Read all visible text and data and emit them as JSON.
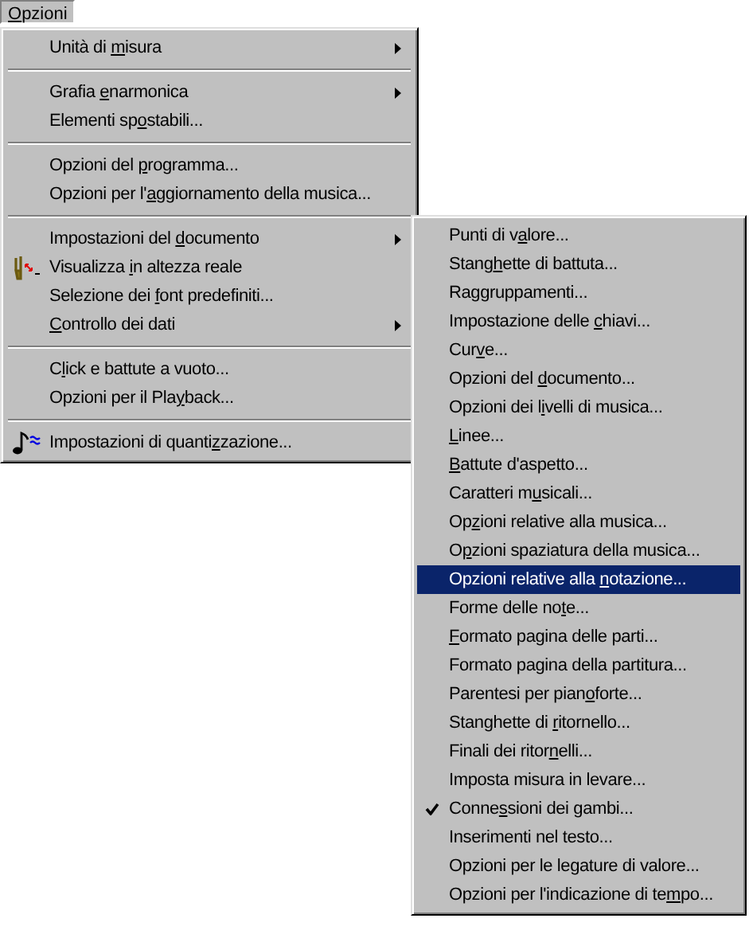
{
  "menu_bar": [
    {
      "label": {
        "key": "O",
        "after": "pzioni"
      },
      "selected": true
    }
  ],
  "menu": [
    {
      "kind": "submenu",
      "label": {
        "before": "Unità di ",
        "key": "m",
        "after": "isura"
      }
    },
    {
      "kind": "separator"
    },
    {
      "kind": "submenu",
      "label": {
        "before": "Grafia ",
        "key": "e",
        "after": "narmonica"
      }
    },
    {
      "kind": "command",
      "label": {
        "before": "Elementi sp",
        "key": "o",
        "after": "stabili..."
      }
    },
    {
      "kind": "separator"
    },
    {
      "kind": "command",
      "label": {
        "before": "Opzioni del ",
        "key": "p",
        "after": "rogramma..."
      }
    },
    {
      "kind": "command",
      "label": {
        "before": "Opzioni per l'",
        "key": "a",
        "after": "ggiornamento della musica..."
      }
    },
    {
      "kind": "separator"
    },
    {
      "kind": "submenu",
      "label": {
        "before": "Impostazioni del ",
        "key": "d",
        "after": "ocumento"
      }
    },
    {
      "kind": "pitch-command",
      "label": {
        "before": "Visualizza ",
        "key": "i",
        "after": "n altezza reale"
      }
    },
    {
      "kind": "command",
      "label": {
        "before": "Selezione dei ",
        "key": "f",
        "after": "ont predefiniti..."
      }
    },
    {
      "kind": "submenu",
      "label": {
        "key": "C",
        "after": "ontrollo dei dati"
      }
    },
    {
      "kind": "separator"
    },
    {
      "kind": "command",
      "label": {
        "before": "C",
        "key": "l",
        "after": "ick e battute a vuoto..."
      }
    },
    {
      "kind": "command",
      "label": {
        "before": "Opzioni per il Pla",
        "key": "y",
        "after": "back..."
      }
    },
    {
      "kind": "separator"
    },
    {
      "kind": "quantize-command",
      "label": {
        "before": "Impostazioni di quanti",
        "key": "z",
        "after": "zazione..."
      }
    }
  ],
  "submenu": [
    {
      "label": {
        "before": "Punti di v",
        "key": "a",
        "after": "lore..."
      },
      "checked": false,
      "selected": false
    },
    {
      "label": {
        "before": "Stang",
        "key": "h",
        "after": "ette di battuta..."
      },
      "checked": false,
      "selected": false
    },
    {
      "label": {
        "before": "Raggruppamenti..."
      },
      "checked": false,
      "selected": false
    },
    {
      "label": {
        "before": "Impostazione delle ",
        "key": "c",
        "after": "hiavi..."
      },
      "checked": false,
      "selected": false
    },
    {
      "label": {
        "before": "Cur",
        "key": "v",
        "after": "e..."
      },
      "checked": false,
      "selected": false
    },
    {
      "label": {
        "before": "Opzioni del ",
        "key": "d",
        "after": "ocumento..."
      },
      "checked": false,
      "selected": false
    },
    {
      "label": {
        "before": "Opzioni dei l",
        "key": "i",
        "after": "velli di musica..."
      },
      "checked": false,
      "selected": false
    },
    {
      "label": {
        "key": "L",
        "after": "inee..."
      },
      "checked": false,
      "selected": false
    },
    {
      "label": {
        "key": "B",
        "after": "attute d'aspetto..."
      },
      "checked": false,
      "selected": false
    },
    {
      "label": {
        "before": "Caratteri m",
        "key": "u",
        "after": "sicali..."
      },
      "checked": false,
      "selected": false
    },
    {
      "label": {
        "before": "Op",
        "key": "z",
        "after": "ioni relative alla musica..."
      },
      "checked": false,
      "selected": false
    },
    {
      "label": {
        "before": "O",
        "key": "p",
        "after": "zioni spaziatura della musica..."
      },
      "checked": false,
      "selected": false
    },
    {
      "label": {
        "before": "Opzioni relative alla ",
        "key": "n",
        "after": "otazione..."
      },
      "checked": false,
      "selected": true
    },
    {
      "label": {
        "before": "Forme delle no",
        "key": "t",
        "after": "e..."
      },
      "checked": false,
      "selected": false
    },
    {
      "label": {
        "key": "F",
        "after": "ormato pagina delle parti..."
      },
      "checked": false,
      "selected": false
    },
    {
      "label": {
        "before": "Formato pagina della partitura..."
      },
      "checked": false,
      "selected": false
    },
    {
      "label": {
        "before": "Parentesi per pian",
        "key": "o",
        "after": "forte..."
      },
      "checked": false,
      "selected": false
    },
    {
      "label": {
        "before": "Stanghette di ",
        "key": "r",
        "after": "itornello..."
      },
      "checked": false,
      "selected": false
    },
    {
      "label": {
        "before": "Finali dei ritor",
        "key": "n",
        "after": "elli..."
      },
      "checked": false,
      "selected": false
    },
    {
      "label": {
        "before": "Imposta misura in levare..."
      },
      "checked": false,
      "selected": false
    },
    {
      "label": {
        "before": "Conne",
        "key": "s",
        "after": "sioni dei gambi..."
      },
      "checked": true,
      "selected": false
    },
    {
      "label": {
        "before": "Inserimenti nel testo..."
      },
      "checked": false,
      "selected": false
    },
    {
      "label": {
        "before": "Opzioni per le legature di valore..."
      },
      "checked": false,
      "selected": false
    },
    {
      "label": {
        "before": "Opzioni per l'indicazione di te",
        "key": "m",
        "after": "po..."
      },
      "checked": false,
      "selected": false
    }
  ]
}
